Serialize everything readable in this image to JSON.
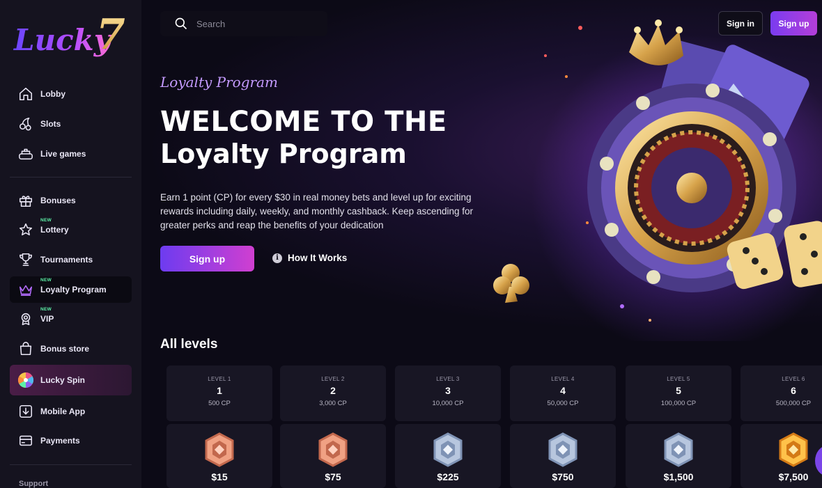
{
  "brand": {
    "logo_text": "Lucky",
    "logo_number": "7"
  },
  "sidebar": {
    "items": [
      {
        "label": "Lobby",
        "icon": "home-icon"
      },
      {
        "label": "Slots",
        "icon": "cherries-icon"
      },
      {
        "label": "Live games",
        "icon": "roulette-table-icon"
      },
      {
        "label": "Bonuses",
        "icon": "gift-icon"
      },
      {
        "label": "Lottery",
        "icon": "star-icon",
        "badge": "NEW"
      },
      {
        "label": "Tournaments",
        "icon": "trophy-icon"
      },
      {
        "label": "Loyalty Program",
        "icon": "crown-icon",
        "badge": "NEW",
        "active": true
      },
      {
        "label": "VIP",
        "icon": "medal-icon",
        "badge": "NEW"
      },
      {
        "label": "Bonus store",
        "icon": "shopping-bag-icon"
      },
      {
        "label": "Lucky Spin",
        "icon": "wheel-icon"
      },
      {
        "label": "Mobile App",
        "icon": "download-icon"
      },
      {
        "label": "Payments",
        "icon": "card-icon"
      }
    ],
    "support_label": "Support"
  },
  "header": {
    "search_placeholder": "Search",
    "signin_label": "Sign in",
    "signup_label": "Sign up"
  },
  "hero": {
    "kicker": "Loyalty Program",
    "title_line1": "WELCOME TO THE",
    "title_line2": "Loyalty Program",
    "description": "Earn 1 point (CP) for every $30 in real money bets and level up for exciting rewards including daily, weekly, and monthly cashback. Keep ascending for greater perks and reap the benefits of your dedication",
    "cta_label": "Sign up",
    "how_label": "How It Works"
  },
  "levels": {
    "title": "All levels",
    "items": [
      {
        "tag": "LEVEL 1",
        "number": "1",
        "points": "500 CP",
        "reward": "$15",
        "medal": "bronze"
      },
      {
        "tag": "LEVEL 2",
        "number": "2",
        "points": "3,000 CP",
        "reward": "$75",
        "medal": "bronze"
      },
      {
        "tag": "LEVEL 3",
        "number": "3",
        "points": "10,000 CP",
        "reward": "$225",
        "medal": "silver"
      },
      {
        "tag": "LEVEL 4",
        "number": "4",
        "points": "50,000 CP",
        "reward": "$750",
        "medal": "silver"
      },
      {
        "tag": "LEVEL 5",
        "number": "5",
        "points": "100,000 CP",
        "reward": "$1,500",
        "medal": "silver"
      },
      {
        "tag": "LEVEL 6",
        "number": "6",
        "points": "500,000 CP",
        "reward": "$7,500",
        "medal": "gold"
      }
    ]
  },
  "colors": {
    "accent": "#7a3cf0",
    "accent2": "#c03ed6",
    "new_badge": "#5df2a8",
    "kicker": "#c59bff"
  }
}
